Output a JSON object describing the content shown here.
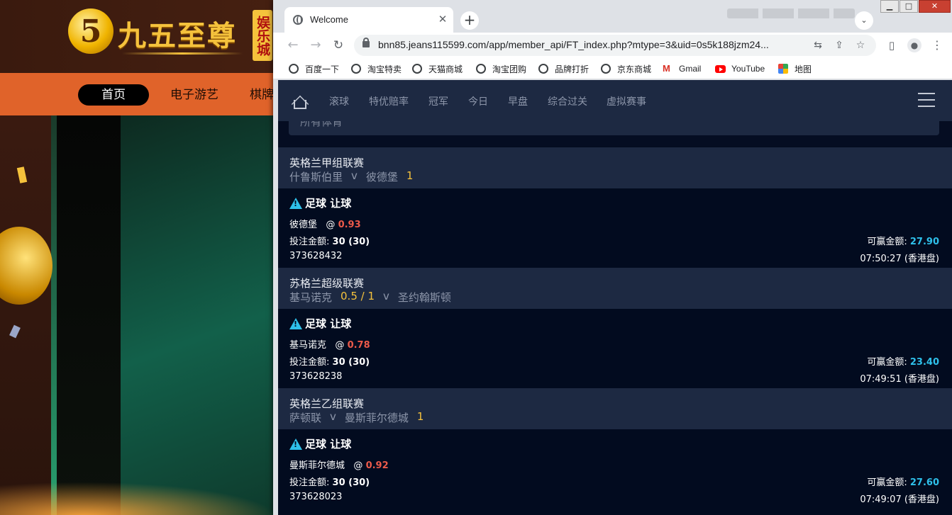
{
  "background_site": {
    "logo_mark": "5",
    "logo_text": "九五至尊",
    "logo_badge": "娱乐城",
    "nav": [
      "首页",
      "电子游艺",
      "棋牌"
    ]
  },
  "browser": {
    "tab_title": "Welcome",
    "tab_close": "✕",
    "new_tab": "+",
    "url": "bnn85.jeans115599.com/app/member_api/FT_index.php?mtype=3&uid=0s5k188jzm24...",
    "bookmarks": [
      "百度一下",
      "淘宝特卖",
      "天猫商城",
      "淘宝团购",
      "品牌打折",
      "京东商城",
      "Gmail",
      "YouTube",
      "地图"
    ],
    "icons": {
      "back": "←",
      "forward": "→",
      "reload": "↻",
      "translate": "⇆",
      "share": "⇪",
      "star": "☆",
      "sidepanel": "▯",
      "profile": "●",
      "menu": "⋮",
      "search": "⌄",
      "minimize": "▁",
      "maximize": "□",
      "close": "✕"
    }
  },
  "site": {
    "tabs": [
      "滚球",
      "特优赔率",
      "冠军",
      "今日",
      "早盘",
      "综合过关",
      "虚拟赛事"
    ],
    "filter": "所有体育"
  },
  "labels": {
    "at": "@",
    "stake": "投注金额:",
    "win": "可赢金额:",
    "vs": "v"
  },
  "bets": [
    {
      "league": "英格兰甲组联赛",
      "home": "什鲁斯伯里",
      "away": "彼德堡",
      "handicap_after": "1",
      "type": "足球 让球",
      "pick": "彼德堡",
      "odds": "0.93",
      "stake": "30 (30)",
      "win": "27.90",
      "ticket": "373628432",
      "time": "07:50:27 (香港盘)"
    },
    {
      "league": "苏格兰超级联赛",
      "home": "基马诺克",
      "handicap_mid": "0.5 / 1",
      "away": "圣约翰斯顿",
      "type": "足球 让球",
      "pick": "基马诺克",
      "odds": "0.78",
      "stake": "30 (30)",
      "win": "23.40",
      "ticket": "373628238",
      "time": "07:49:51 (香港盘)"
    },
    {
      "league": "英格兰乙组联赛",
      "home": "萨顿联",
      "away": "曼斯菲尔德城",
      "handicap_after": "1",
      "type": "足球 让球",
      "pick": "曼斯菲尔德城",
      "odds": "0.92",
      "stake": "30 (30)",
      "win": "27.60",
      "ticket": "373628023",
      "time": "07:49:07 (香港盘)"
    }
  ]
}
